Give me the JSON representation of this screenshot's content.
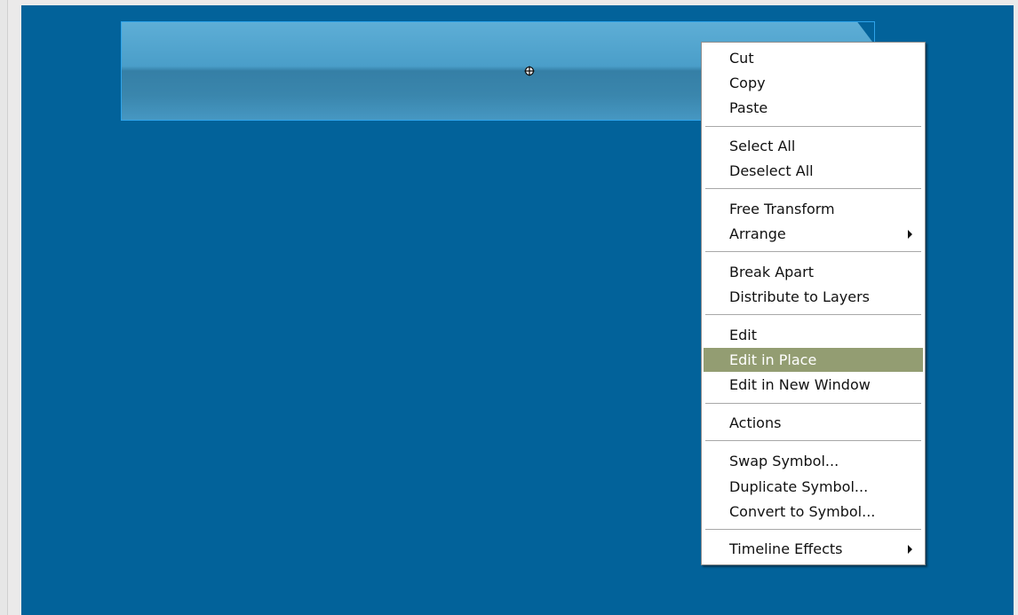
{
  "colors": {
    "stage": "#02629a",
    "symbol_border": "#32a8ea",
    "menu_highlight": "#939d72"
  },
  "context_menu": {
    "items": [
      {
        "label": "Cut"
      },
      {
        "label": "Copy"
      },
      {
        "label": "Paste"
      },
      {
        "label": "Select All"
      },
      {
        "label": "Deselect All"
      },
      {
        "label": "Free Transform"
      },
      {
        "label": "Arrange",
        "submenu": true
      },
      {
        "label": "Break Apart"
      },
      {
        "label": "Distribute to Layers"
      },
      {
        "label": "Edit"
      },
      {
        "label": "Edit in Place",
        "highlighted": true
      },
      {
        "label": "Edit in New Window"
      },
      {
        "label": "Actions"
      },
      {
        "label": "Swap Symbol..."
      },
      {
        "label": "Duplicate Symbol..."
      },
      {
        "label": "Convert to Symbol..."
      },
      {
        "label": "Timeline Effects",
        "submenu": true
      }
    ]
  },
  "icons": {
    "registration_point": "crosshair-circle-icon",
    "submenu_arrow": "triangle-right-icon"
  }
}
